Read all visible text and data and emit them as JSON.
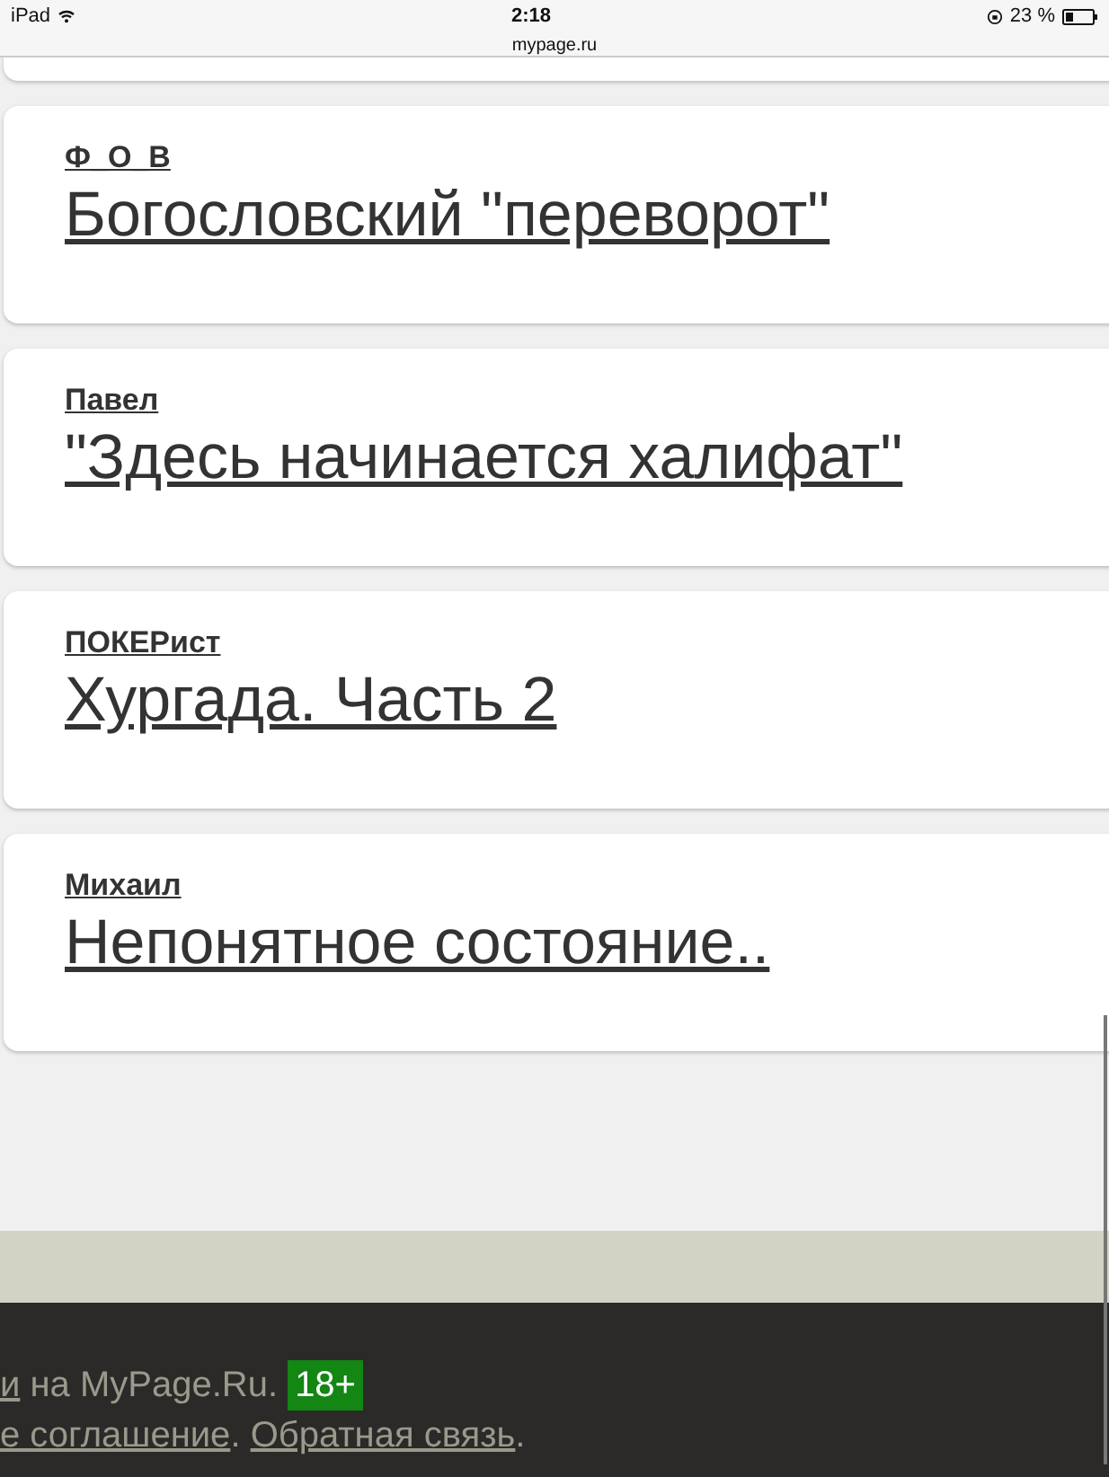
{
  "status_bar": {
    "device": "iPad",
    "time": "2:18",
    "battery": "23 %",
    "url": "mypage.ru"
  },
  "posts": [
    {
      "author": "Ф_О_В",
      "title": "Богословский \"переворот\""
    },
    {
      "author": "Павел",
      "title": "\"Здесь начинается халифат\""
    },
    {
      "author": "ПОКЕРист",
      "title": "Хургада. Часть 2"
    },
    {
      "author": "Михаил",
      "title": "Непонятное состояние.."
    }
  ],
  "footer": {
    "line_1": [
      {
        "kind": "link",
        "text": "и"
      },
      {
        "kind": "text",
        "text": " на MyPage.Ru. "
      },
      {
        "kind": "badge",
        "text": "18+"
      }
    ],
    "line_2": [
      {
        "kind": "link",
        "text": "е соглашение"
      },
      {
        "kind": "text",
        "text": ". "
      },
      {
        "kind": "link",
        "text": "Обратная связь"
      },
      {
        "kind": "text",
        "text": "."
      }
    ]
  }
}
